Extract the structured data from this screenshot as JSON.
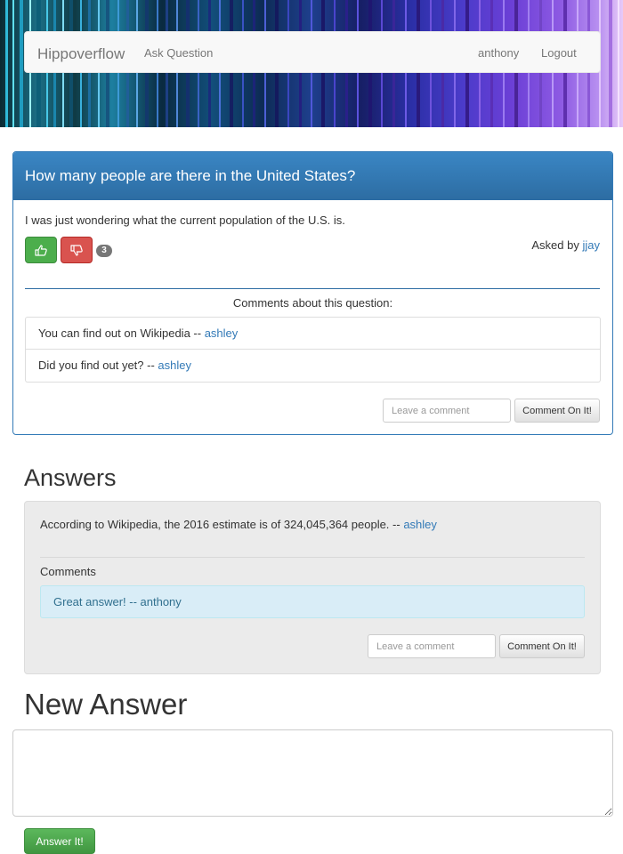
{
  "app": {
    "brand": "Hippoverflow",
    "nav_ask": "Ask Question",
    "user": "anthony",
    "logout": "Logout"
  },
  "question": {
    "title": "How many people are there in the United States?",
    "body": "I was just wondering what the current population of the U.S. is.",
    "score": "3",
    "asked_by_prefix": "Asked by",
    "author": "jjay",
    "comments_title": "Comments about this question:",
    "comments": [
      {
        "text": "You can find out on Wikipedia --",
        "author": "ashley"
      },
      {
        "text": "Did you find out yet? --",
        "author": "ashley"
      }
    ],
    "comment_placeholder": "Leave a comment",
    "comment_button": "Comment On It!"
  },
  "answers": {
    "heading": "Answers",
    "items": [
      {
        "text": "According to Wikipedia, the 2016 estimate is of 324,045,364 people. --",
        "author": "ashley",
        "comments_title": "Comments",
        "comments": [
          {
            "text": "Great answer! -- anthony"
          }
        ],
        "comment_placeholder": "Leave a comment",
        "comment_button": "Comment On It!"
      }
    ]
  },
  "new_answer": {
    "heading": "New Answer",
    "button": "Answer It!"
  },
  "colors": {
    "primary": "#337ab7",
    "success": "#5cb85c",
    "danger": "#d9534f",
    "info_bg": "#d9edf7"
  },
  "icons": {
    "upvote": "thumbs-up-icon",
    "downvote": "thumbs-down-icon"
  }
}
